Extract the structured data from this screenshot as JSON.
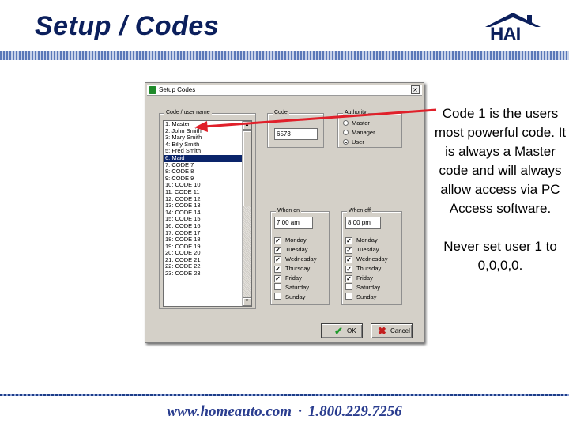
{
  "slide": {
    "title": "Setup / Codes",
    "logo_text": "HAI",
    "callout_1": "Code 1 is the users most powerful code.  It is always a Master code and will always allow access via PC Access software.",
    "callout_2": "Never set user 1 to 0,0,0,0.",
    "footer_url": "www.homeauto.com",
    "footer_sep": "·",
    "footer_phone": "1.800.229.7256",
    "colors": {
      "title": "#0b1f5c",
      "arrow": "#e0202a",
      "footer": "#2a3d8f",
      "selection": "#0a246a"
    }
  },
  "dialog": {
    "title": "Setup Codes",
    "close_label": "×",
    "codes_group_label": "Code / user name",
    "codes": [
      "1: Master",
      "2: John Smith",
      "3: Mary Smith",
      "4: Billy Smith",
      "5: Fred Smith",
      "6: Maid",
      "7: CODE 7",
      "8: CODE 8",
      "9: CODE 9",
      "10: CODE 10",
      "11: CODE 11",
      "12: CODE 12",
      "13: CODE 13",
      "14: CODE 14",
      "15: CODE 15",
      "16: CODE 16",
      "17: CODE 17",
      "18: CODE 18",
      "19: CODE 19",
      "20: CODE 20",
      "21: CODE 21",
      "22: CODE 22",
      "23: CODE 23"
    ],
    "selected_code": "6: Maid",
    "code_group_label": "Code",
    "code_value": "6573",
    "authority_group_label": "Authority",
    "authority_options": [
      "Master",
      "Manager",
      "User"
    ],
    "authority_selected": "User",
    "when_on_1_label": "When on",
    "when_on_1_value": "7:00 am",
    "when_off_1_label": "When off",
    "when_off_1_value": "8:00 pm",
    "days": [
      "Monday",
      "Tuesday",
      "Wednesday",
      "Thursday",
      "Friday",
      "Saturday",
      "Sunday"
    ],
    "days_checked_1": [
      true,
      true,
      true,
      true,
      true,
      false,
      false
    ],
    "days_checked_2": [
      true,
      true,
      true,
      true,
      true,
      false,
      false
    ],
    "ok_label": "OK",
    "cancel_label": "Cancel"
  }
}
